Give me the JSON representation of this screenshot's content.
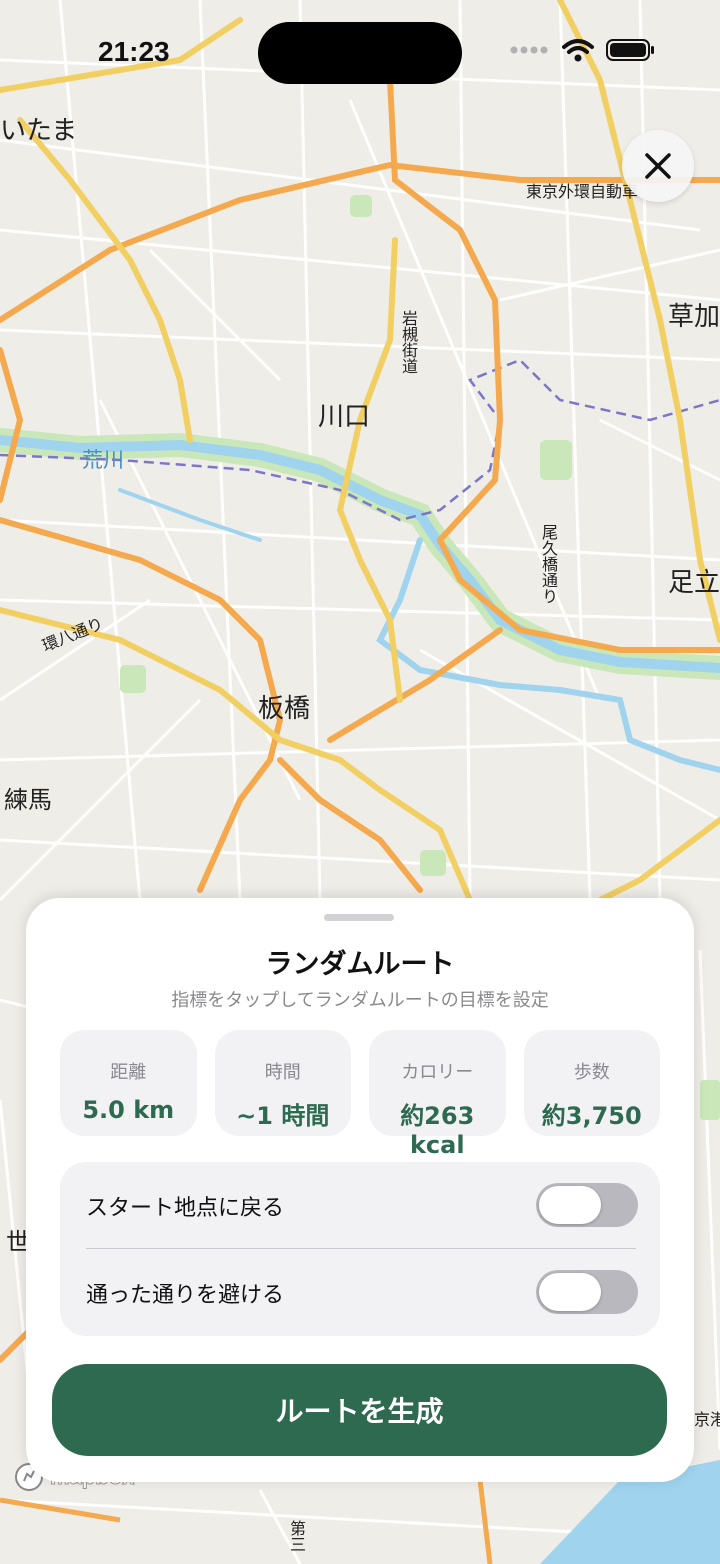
{
  "status": {
    "time": "21:23"
  },
  "map": {
    "labels": [
      {
        "id": "saitama",
        "text": "いたま"
      },
      {
        "id": "kawaguchi",
        "text": "川口"
      },
      {
        "id": "arakawa",
        "text": "荒川"
      },
      {
        "id": "itabashi",
        "text": "板橋"
      },
      {
        "id": "nerima",
        "text": "練馬"
      },
      {
        "id": "souka",
        "text": "草加"
      },
      {
        "id": "adachi",
        "text": "足立"
      },
      {
        "id": "gaikan",
        "text": "東京外環自動車"
      },
      {
        "id": "iwatsuki",
        "text": "岩槻街道"
      },
      {
        "id": "okubashi",
        "text": "尾久橋通り"
      },
      {
        "id": "kanpachi",
        "text": "環八通り"
      },
      {
        "id": "setagaya",
        "text": "世"
      },
      {
        "id": "keiyo",
        "text": "京港"
      },
      {
        "id": "daisan",
        "text": "第三"
      }
    ],
    "attribution": "mapbox"
  },
  "sheet": {
    "title": "ランダムルート",
    "subtitle": "指標をタップしてランダムルートの目標を設定",
    "metrics": [
      {
        "label": "距離",
        "value": "5.0 km"
      },
      {
        "label": "時間",
        "value": "~1 時間"
      },
      {
        "label": "カロリー",
        "value": "約263 kcal"
      },
      {
        "label": "歩数",
        "value": "約3,750"
      }
    ],
    "toggles": [
      {
        "label": "スタート地点に戻る",
        "on": false
      },
      {
        "label": "通った通りを避ける",
        "on": false
      }
    ],
    "generate_label": "ルートを生成"
  },
  "colors": {
    "accent": "#2d6a4f",
    "map_bg": "#efede8",
    "water": "#9fd3ee",
    "park": "#c9e7b8",
    "arterial": "#f5a94e",
    "highway": "#f2cf63"
  }
}
